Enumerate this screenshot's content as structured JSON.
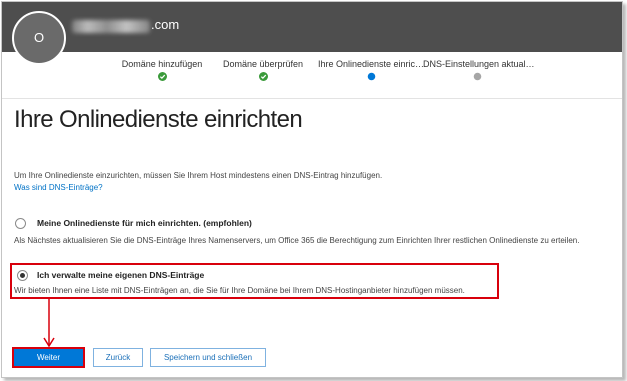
{
  "header": {
    "avatar_initial": "O",
    "domain_suffix": ".com"
  },
  "steps": [
    {
      "label": "Domäne hinzufügen",
      "status": "done",
      "icon": "check-icon"
    },
    {
      "label": "Domäne überprüfen",
      "status": "done",
      "icon": "check-icon"
    },
    {
      "label": "Ihre Onlinedienste einric…",
      "status": "current",
      "icon": "current-step-dot-icon"
    },
    {
      "label": "DNS-Einstellungen aktual…",
      "status": "pending",
      "icon": "pending-step-dot-icon"
    }
  ],
  "page_title": "Ihre Onlinedienste einrichten",
  "intro": {
    "text": "Um Ihre Onlinedienste einzurichten, müssen Sie Ihrem Host mindestens einen DNS-Eintrag hinzufügen.",
    "link": "Was sind DNS-Einträge?"
  },
  "options": [
    {
      "label": "Meine Onlinedienste für mich einrichten. (empfohlen)",
      "description": "Als Nächstes aktualisieren Sie die DNS-Einträge Ihres Namenservers, um Office 365 die Berechtigung zum Einrichten Ihrer restlichen Onlinedienste zu erteilen.",
      "selected": false
    },
    {
      "label": "Ich verwalte meine eigenen DNS-Einträge",
      "description": "Wir bieten Ihnen eine Liste mit DNS-Einträgen an, die Sie für Ihre Domäne bei Ihrem DNS-Hostinganbieter hinzufügen müssen.",
      "selected": true
    }
  ],
  "buttons": {
    "next": "Weiter",
    "back": "Zurück",
    "save_close": "Speichern und schließen"
  },
  "colors": {
    "header": "#4e4e4e",
    "accent": "#0078d7",
    "done": "#3a9a3a",
    "pending": "#a6a6a6",
    "highlight": "#d8000c"
  }
}
